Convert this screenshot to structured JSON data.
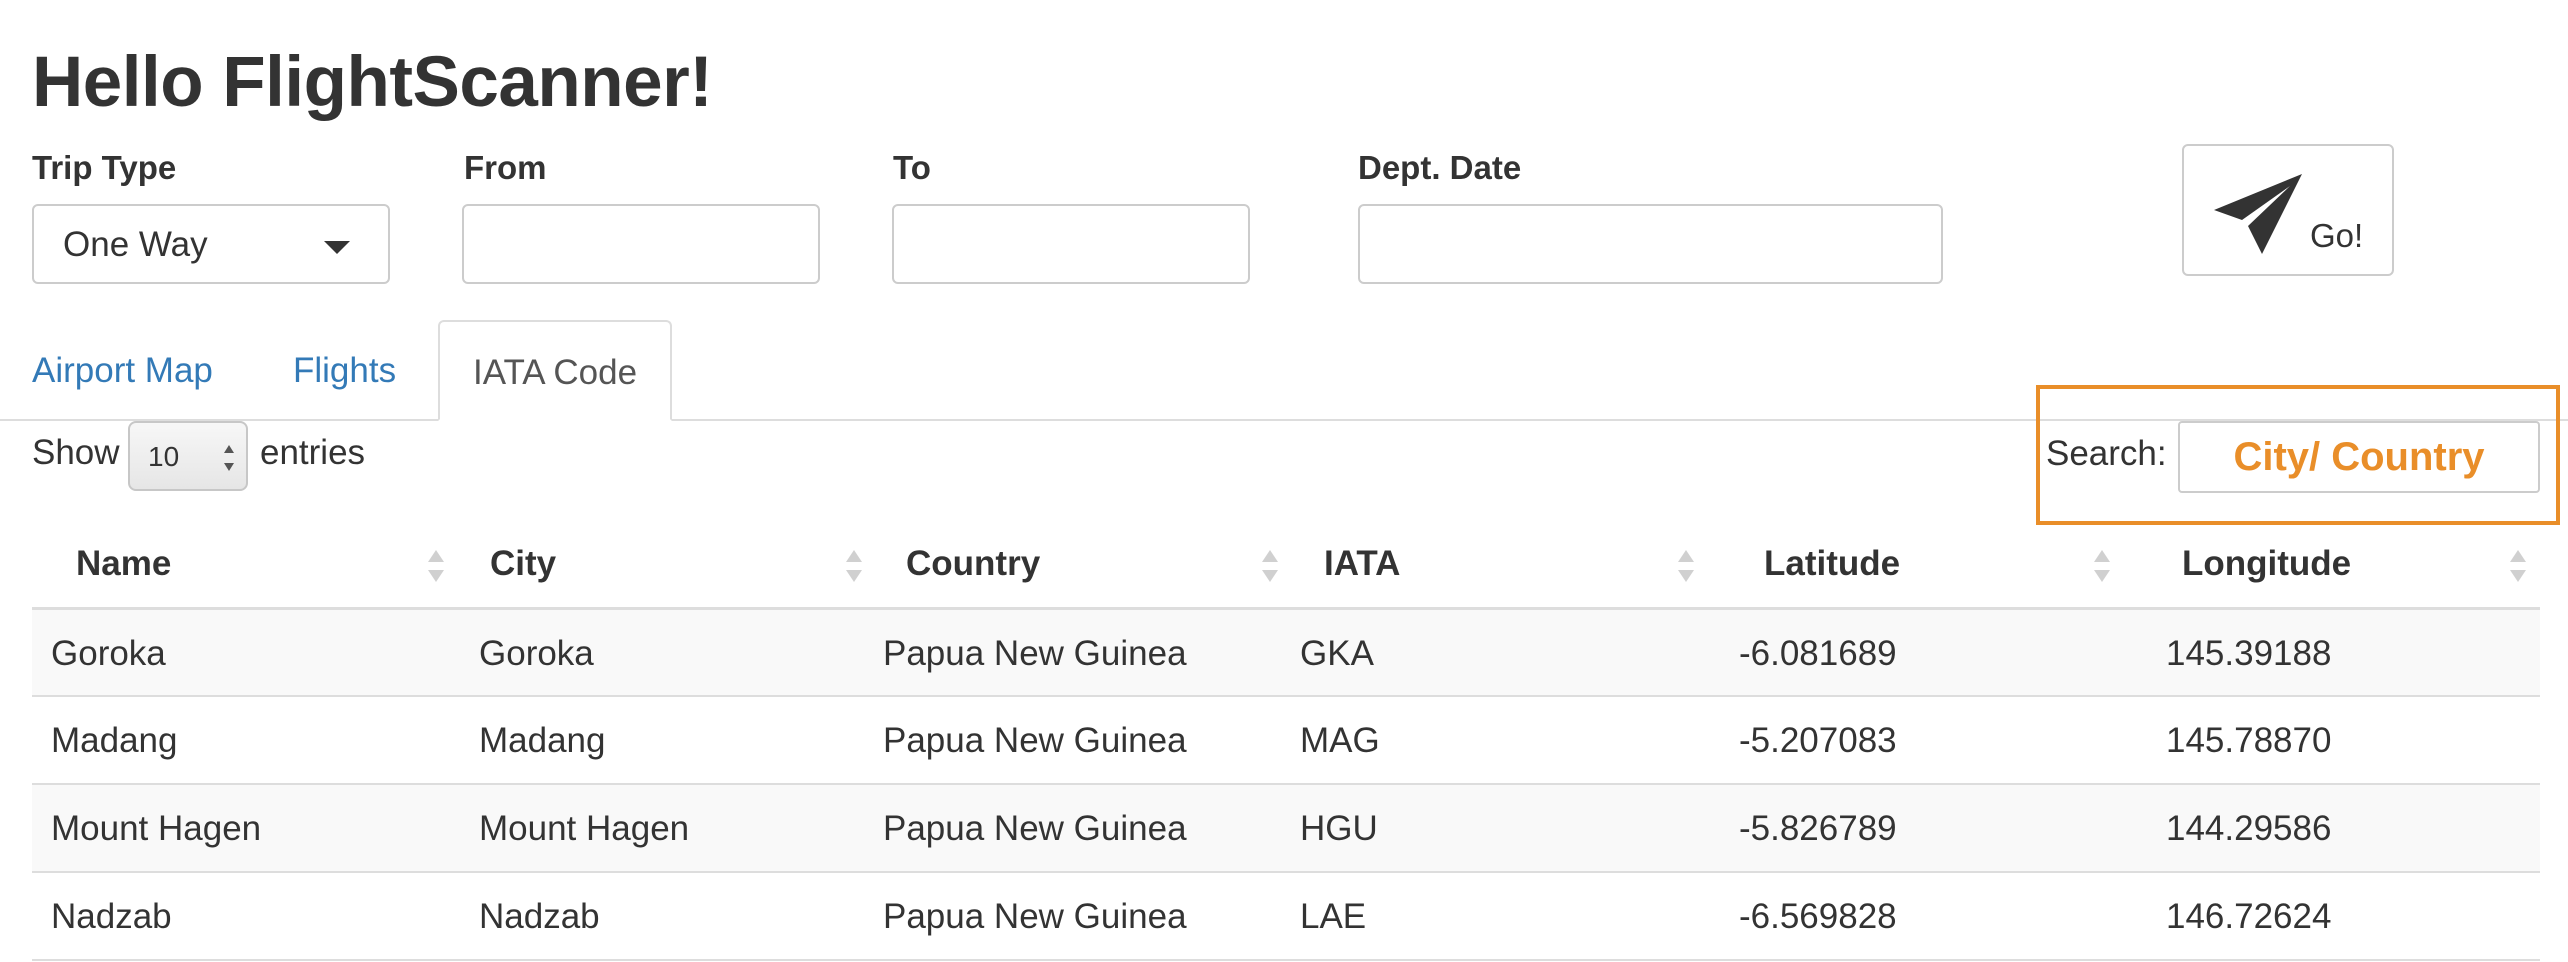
{
  "page_title": "Hello FlightScanner!",
  "form": {
    "trip_type_label": "Trip Type",
    "trip_type_value": "One Way",
    "from_label": "From",
    "from_value": "",
    "to_label": "To",
    "to_value": "",
    "dept_date_label": "Dept. Date",
    "dept_date_value": "",
    "go_button_label": "Go!",
    "go_button_icon": "paper-plane-icon"
  },
  "tabs": [
    {
      "label": "Airport Map",
      "active": false
    },
    {
      "label": "Flights",
      "active": false
    },
    {
      "label": "IATA Code",
      "active": true
    }
  ],
  "table_controls": {
    "show_label": "Show",
    "entries_value": "10",
    "entries_label": "entries",
    "search_label": "Search:",
    "search_placeholder": "City/ Country",
    "highlight_color": "#e98e29"
  },
  "table": {
    "columns": [
      "Name",
      "City",
      "Country",
      "IATA",
      "Latitude",
      "Longitude"
    ],
    "rows": [
      [
        "Goroka",
        "Goroka",
        "Papua New Guinea",
        "GKA",
        "-6.081689",
        "145.39188"
      ],
      [
        "Madang",
        "Madang",
        "Papua New Guinea",
        "MAG",
        "-5.207083",
        "145.78870"
      ],
      [
        "Mount Hagen",
        "Mount Hagen",
        "Papua New Guinea",
        "HGU",
        "-5.826789",
        "144.29586"
      ],
      [
        "Nadzab",
        "Nadzab",
        "Papua New Guinea",
        "LAE",
        "-6.569828",
        "146.72624"
      ]
    ]
  },
  "colors": {
    "link": "#337ab7",
    "text": "#333333",
    "border": "#dddddd",
    "stripe": "#f9f9f9"
  }
}
